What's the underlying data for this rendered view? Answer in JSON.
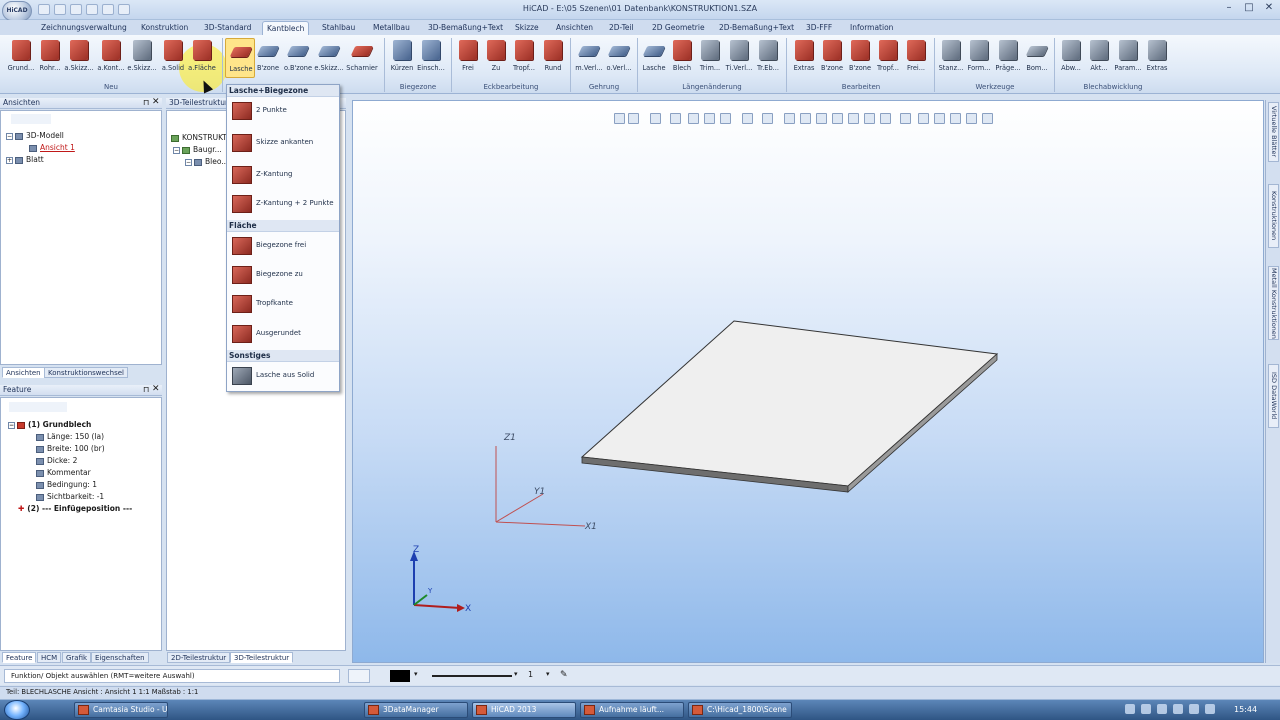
{
  "window": {
    "app_logo": "HiCAD",
    "title": "HiCAD - E:\\05 Szenen\\01 Datenbank\\KONSTRUKTION1.SZA",
    "controls": [
      "–",
      "□",
      "✕"
    ]
  },
  "tabs": [
    "Zeichnungsverwaltung",
    "Konstruktion",
    "3D-Standard",
    "Kantblech",
    "Stahlbau",
    "Metallbau",
    "3D-Bemaßung+Text",
    "Skizze",
    "Ansichten",
    "2D-Teil",
    "2D Geometrie",
    "2D-Bemaßung+Text",
    "3D-FFF",
    "Information"
  ],
  "active_tab": "Kantblech",
  "ribbon": {
    "groups": [
      "Neu",
      "Biegezone",
      "Eckbearbeitung",
      "Gehrung",
      "Längenänderung",
      "Bearbeiten",
      "Werkzeuge",
      "Blechabwicklung"
    ],
    "buttons": [
      "Grund...",
      "Rohr...",
      "a.Skizz...",
      "a.Kont...",
      "e.Skizz...",
      "a.Solid",
      "a.Fläche",
      "Lasche",
      "B'zone",
      "o.B'zone",
      "e.Skizz...",
      "Scharnier",
      "Kürzen",
      "Einsch...",
      "Frei",
      "Zu",
      "Tropf...",
      "Rund",
      "m.Verl...",
      "o.Verl...",
      "Lasche",
      "Blech",
      "Trim...",
      "Ti.Verl...",
      "Tr.Eb...",
      "Extras",
      "B'zone",
      "B'zone",
      "Tropf...",
      "Frei...",
      "Stanz...",
      "Form...",
      "Präge...",
      "Bom...",
      "Abw...",
      "Akt...",
      "Param...",
      "Extras"
    ]
  },
  "panels": {
    "ansichten": {
      "title": "Ansichten",
      "tree": [
        "3D-Modell",
        "Ansicht 1",
        "Blatt"
      ],
      "tabs": [
        "Ansichten",
        "Konstruktionswechsel"
      ]
    },
    "teilestruktur": {
      "title": "3D-Teilestruktur",
      "tree": [
        "KONSTRUKT...",
        "Baugr...",
        "Bleo..."
      ]
    },
    "feature": {
      "title": "Feature",
      "tree": [
        "(1) Grundblech",
        "Länge: 150 (la)",
        "Breite: 100 (br)",
        "Dicke: 2",
        "Kommentar",
        "Bedingung: 1",
        "Sichtbarkeit: -1",
        "(2) --- Einfügeposition ---"
      ]
    },
    "bottom_tabs": [
      "Feature",
      "HCM",
      "Grafik",
      "Eigenschaften",
      "2D-Teilestruktur",
      "3D-Teilestruktur"
    ]
  },
  "dropdown": {
    "sections": [
      {
        "title": "Lasche+Biegezone",
        "items": [
          "2 Punkte",
          "Skizze ankanten",
          "Z-Kantung",
          "Z-Kantung + 2 Punkte"
        ]
      },
      {
        "title": "Fläche",
        "items": [
          "Biegezone frei",
          "Biegezone zu",
          "Tropfkante",
          "Ausgerundet"
        ]
      },
      {
        "title": "Sonstiges",
        "items": [
          "Lasche aus Solid"
        ]
      }
    ]
  },
  "viewport": {
    "axis_labels": {
      "z1": "Z1",
      "y1": "Y1",
      "x1": "X1",
      "z": "Z",
      "y": "Y",
      "x": "X"
    }
  },
  "right_tabs": [
    "Virtuelle Blätter",
    "Konstruktionen",
    "Metall Konstruktionen",
    "ISD DataWorld"
  ],
  "toolbar2": {
    "line_width": "1"
  },
  "status": {
    "prompt": "Funktion/ Objekt auswählen (RMT=weitere Auswahl)",
    "info": "Teil: BLECHLASCHE  Ansicht : Ansicht 1 1:1  Maßstab : 1:1"
  },
  "taskbar": {
    "tasks": [
      "Camtasia Studio - U...",
      "3DataManager",
      "HiCAD 2013",
      "Aufnahme läuft...",
      "C:\\Hicad_1800\\Scene"
    ],
    "clock": "15:44"
  },
  "colors": {
    "accent": "#c73a2c",
    "highlight": "#ffec28",
    "viewport_bottom": "#8eb8ea"
  }
}
